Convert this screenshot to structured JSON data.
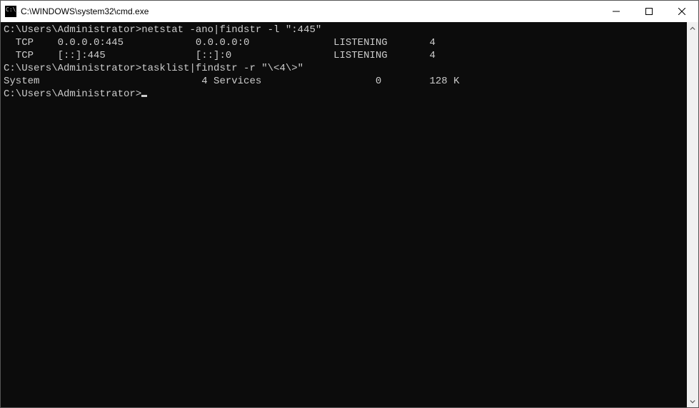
{
  "window": {
    "title": "C:\\WINDOWS\\system32\\cmd.exe"
  },
  "terminal": {
    "lines": [
      "",
      "C:\\Users\\Administrator>netstat -ano|findstr -l \":445\"",
      "  TCP    0.0.0.0:445            0.0.0.0:0              LISTENING       4",
      "  TCP    [::]:445               [::]:0                 LISTENING       4",
      "",
      "C:\\Users\\Administrator>tasklist|findstr -r \"\\<4\\>\"",
      "System                           4 Services                   0        128 K",
      "",
      "C:\\Users\\Administrator>"
    ]
  }
}
